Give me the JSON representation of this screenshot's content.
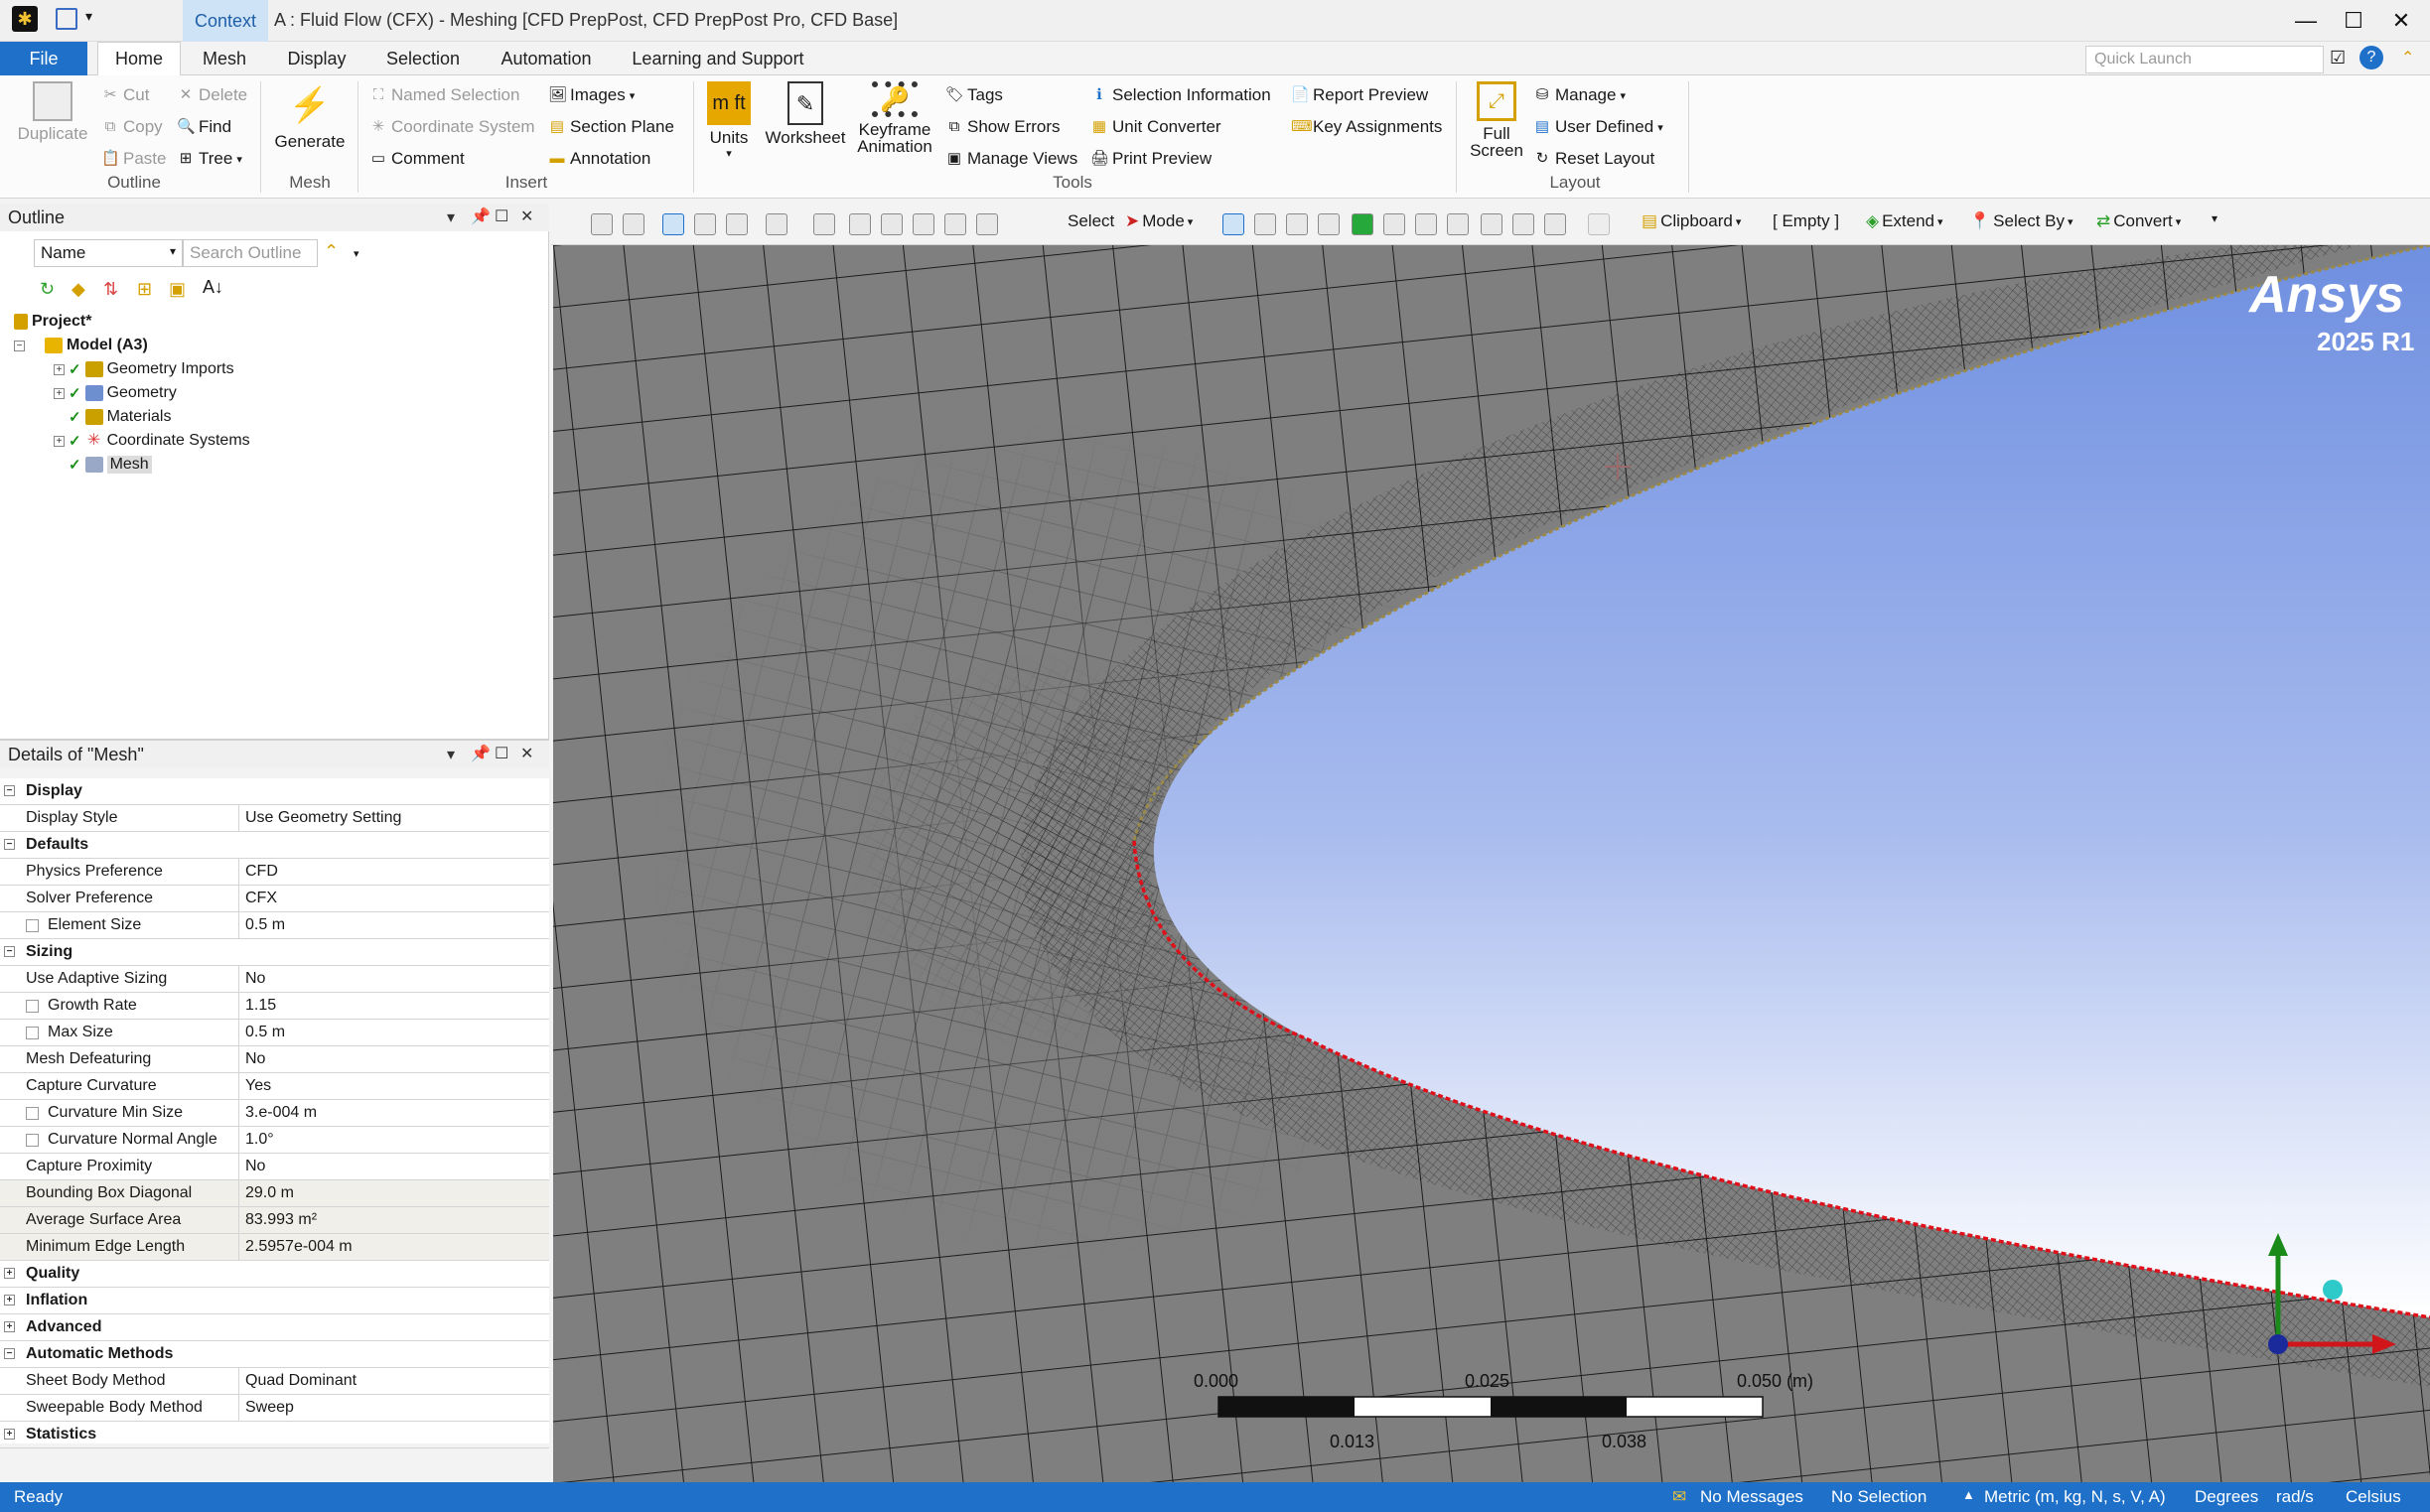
{
  "window": {
    "context_tab": "Context",
    "title": "A : Fluid Flow (CFX) - Meshing [CFD PrepPost, CFD PrepPost Pro, CFD Base]",
    "minimize": "—",
    "maximize": "☐",
    "close": "✕"
  },
  "menu": {
    "file": "File",
    "tabs": [
      "Home",
      "Mesh",
      "Display",
      "Selection",
      "Automation",
      "Learning and Support"
    ],
    "quick_launch_placeholder": "Quick Launch"
  },
  "ribbon": {
    "outline_group": {
      "duplicate": "Duplicate",
      "cut": "Cut",
      "copy": "Copy",
      "paste": "Paste",
      "delete": "Delete",
      "find": "Find",
      "tree": "Tree",
      "label": "Outline"
    },
    "mesh_group": {
      "generate": "Generate",
      "label": "Mesh"
    },
    "insert_group": {
      "named_selection": "Named Selection",
      "coordinate_system": "Coordinate System",
      "comment": "Comment",
      "images": "Images",
      "section_plane": "Section Plane",
      "annotation": "Annotation",
      "label": "Insert"
    },
    "tools_group": {
      "units": "Units",
      "worksheet": "Worksheet",
      "keyframe_animation_1": "Keyframe",
      "keyframe_animation_2": "Animation",
      "tags": "Tags",
      "show_errors": "Show Errors",
      "manage_views": "Manage Views",
      "selection_information": "Selection Information",
      "unit_converter": "Unit Converter",
      "print_preview": "Print Preview",
      "report_preview": "Report Preview",
      "key_assignments": "Key Assignments",
      "label": "Tools"
    },
    "layout_group": {
      "full_screen_1": "Full",
      "full_screen_2": "Screen",
      "manage": "Manage",
      "user_defined": "User Defined",
      "reset_layout": "Reset Layout",
      "label": "Layout"
    }
  },
  "outline": {
    "title": "Outline",
    "name_filter": "Name",
    "search_placeholder": "Search Outline",
    "tree": {
      "project": "Project*",
      "model": "Model (A3)",
      "children": [
        "Geometry Imports",
        "Geometry",
        "Materials",
        "Coordinate Systems",
        "Mesh"
      ]
    }
  },
  "details": {
    "title": "Details of \"Mesh\"",
    "rows": [
      {
        "type": "section",
        "label": "Display",
        "expanded": true
      },
      {
        "label": "Display Style",
        "value": "Use Geometry Setting"
      },
      {
        "type": "section",
        "label": "Defaults",
        "expanded": true
      },
      {
        "label": "Physics Preference",
        "value": "CFD"
      },
      {
        "label": "Solver Preference",
        "value": "CFX"
      },
      {
        "label": "Element Size",
        "value": "0.5 m",
        "checkbox": true
      },
      {
        "type": "section",
        "label": "Sizing",
        "expanded": true
      },
      {
        "label": "Use Adaptive Sizing",
        "value": "No"
      },
      {
        "label": "Growth Rate",
        "value": "1.15",
        "checkbox": true
      },
      {
        "label": "Max Size",
        "value": "0.5 m",
        "checkbox": true
      },
      {
        "label": "Mesh Defeaturing",
        "value": "No"
      },
      {
        "label": "Capture Curvature",
        "value": "Yes"
      },
      {
        "label": "Curvature Min Size",
        "value": "3.e-004 m",
        "checkbox": true
      },
      {
        "label": "Curvature Normal Angle",
        "value": "1.0°",
        "checkbox": true
      },
      {
        "label": "Capture Proximity",
        "value": "No"
      },
      {
        "label": "Bounding Box Diagonal",
        "value": "29.0 m",
        "readonly": true
      },
      {
        "label": "Average Surface Area",
        "value": "83.993 m²",
        "readonly": true
      },
      {
        "label": "Minimum Edge Length",
        "value": "2.5957e-004 m",
        "readonly": true
      },
      {
        "type": "section",
        "label": "Quality",
        "expanded": false
      },
      {
        "type": "section",
        "label": "Inflation",
        "expanded": false
      },
      {
        "type": "section",
        "label": "Advanced",
        "expanded": false
      },
      {
        "type": "section",
        "label": "Automatic Methods",
        "expanded": true
      },
      {
        "label": "Sheet Body Method",
        "value": "Quad Dominant"
      },
      {
        "label": "Sweepable Body Method",
        "value": "Sweep"
      },
      {
        "type": "section",
        "label": "Statistics",
        "expanded": false
      }
    ]
  },
  "viewport_toolbar": {
    "select": "Select",
    "mode": "Mode",
    "clipboard": "Clipboard",
    "empty": "[ Empty ]",
    "extend": "Extend",
    "select_by": "Select By",
    "convert": "Convert"
  },
  "viewport": {
    "brand": "Ansys",
    "version": "2025 R1",
    "scale_labels_top": [
      "0.000",
      "0.025",
      "0.050 (m)"
    ],
    "scale_labels_bottom": [
      "0.013",
      "0.038"
    ]
  },
  "status": {
    "ready": "Ready",
    "messages": "No Messages",
    "selection": "No Selection",
    "units": "Metric (m, kg, N, s, V, A)",
    "angle": "Degrees",
    "rate": "rad/s",
    "temperature": "Celsius"
  },
  "colors": {
    "accent": "#1e70c8",
    "mesh_fill": "#7f7f7f",
    "mesh_line": "#1c1c1c",
    "body_top": "#6f8fe0",
    "body_bottom": "#ffffff"
  }
}
